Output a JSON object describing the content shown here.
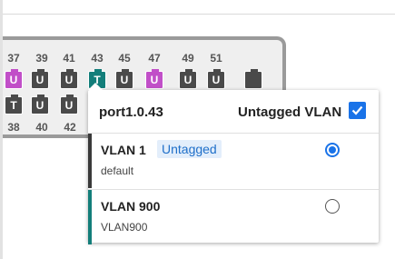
{
  "colors": {
    "port_gray": "#4a4a4a",
    "port_purple": "#c14fc8",
    "port_teal": "#137e7a",
    "accent_vlan1": "#3a3a3a",
    "accent_vlan900": "#137e7a",
    "selected_blue": "#1a73e8"
  },
  "switch": {
    "top_numbers": [
      "37",
      "39",
      "41",
      "43",
      "45",
      "47",
      "49",
      "51"
    ],
    "bottom_numbers": [
      "38",
      "40",
      "42"
    ],
    "top_ports": [
      {
        "label": "U",
        "color": "purple"
      },
      {
        "label": "U",
        "color": "gray"
      },
      {
        "label": "U",
        "color": "gray"
      },
      {
        "label": "T",
        "color": "teal"
      },
      {
        "label": "U",
        "color": "gray"
      },
      {
        "label": "U",
        "color": "purple"
      },
      {
        "label": "U",
        "color": "gray"
      },
      {
        "label": "U",
        "color": "gray"
      },
      {
        "label": "",
        "color": "gray"
      }
    ],
    "bottom_ports": [
      {
        "label": "T",
        "color": "gray"
      },
      {
        "label": "U",
        "color": "gray"
      },
      {
        "label": "U",
        "color": "gray"
      }
    ]
  },
  "popover": {
    "port_name": "port1.0.43",
    "untagged_label": "Untagged VLAN",
    "untagged_checked": true,
    "vlans": [
      {
        "name": "VLAN 1",
        "badge": "Untagged",
        "description": "default",
        "selected": true
      },
      {
        "name": "VLAN 900",
        "badge": "",
        "description": "VLAN900",
        "selected": false
      }
    ]
  }
}
